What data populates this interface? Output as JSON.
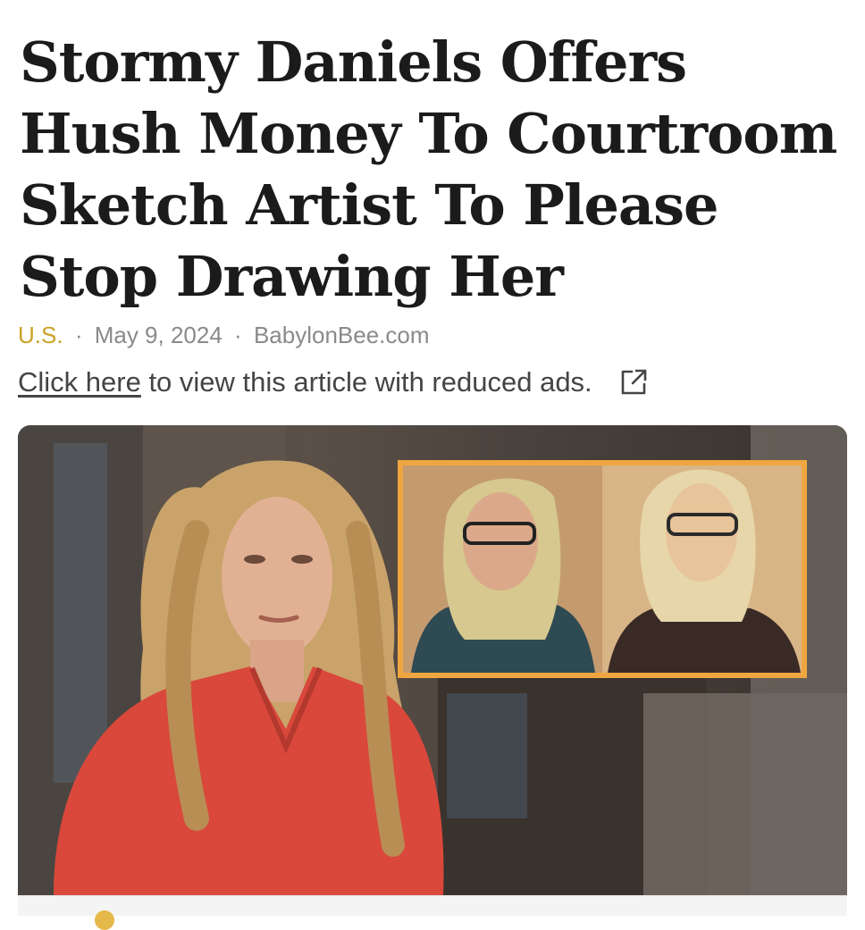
{
  "article": {
    "title": "Stormy Daniels Offers Hush Money To Courtroom Sketch Artist To Please Stop Drawing Her",
    "category": "U.S.",
    "date": "May 9, 2024",
    "source": "BabylonBee.com",
    "separator": "·"
  },
  "reduced_ads": {
    "link_text": "Click here",
    "rest_text": " to view this article with reduced ads.",
    "icon": "external-link-icon"
  },
  "colors": {
    "category": "#c9a227",
    "inset_border": "#f0a640",
    "shirt": "#d9483b"
  }
}
